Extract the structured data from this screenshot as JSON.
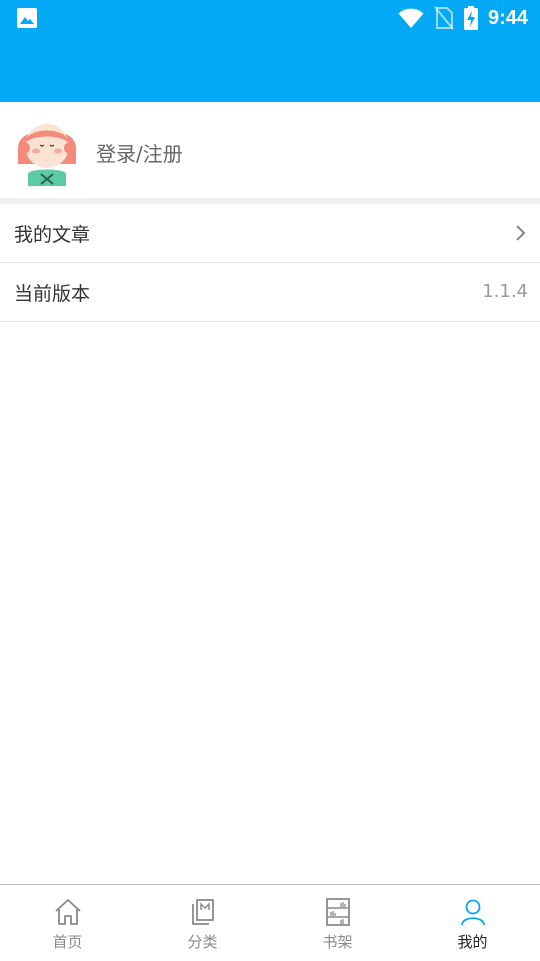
{
  "status_bar": {
    "time": "9:44"
  },
  "profile": {
    "login_label": "登录/注册"
  },
  "menu": [
    {
      "label": "我的文章",
      "value": ""
    },
    {
      "label": "当前版本",
      "value": "1.1.4"
    }
  ],
  "tabbar": {
    "items": [
      {
        "label": "首页",
        "icon": "home-icon"
      },
      {
        "label": "分类",
        "icon": "category-icon"
      },
      {
        "label": "书架",
        "icon": "bookshelf-icon"
      },
      {
        "label": "我的",
        "icon": "user-icon"
      }
    ],
    "active": "我的",
    "active_color": "#03A9F4",
    "inactive_color": "#8a8a8a"
  },
  "colors": {
    "header": "#03A9F4",
    "divider": "#f0f0f0"
  }
}
